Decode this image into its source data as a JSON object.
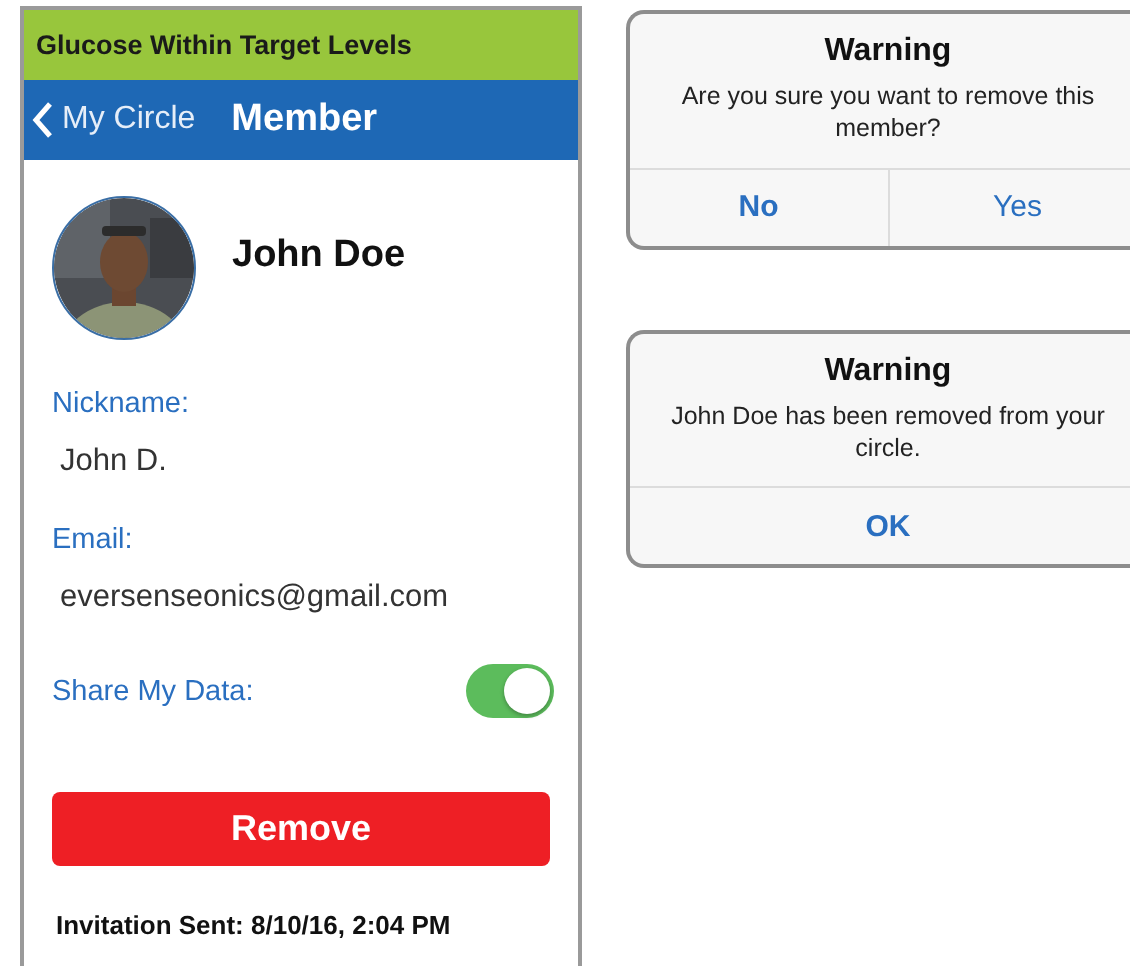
{
  "status_banner": {
    "text": "Glucose Within Target Levels"
  },
  "nav_bar": {
    "back_label": "My Circle",
    "title": "Member"
  },
  "profile": {
    "name": "John Doe"
  },
  "fields": [
    {
      "label": "Nickname:",
      "value": "John D."
    },
    {
      "label": "Email:",
      "value": "eversenseonics@gmail.com"
    }
  ],
  "share_toggle": {
    "label": "Share My Data:",
    "on": true
  },
  "remove_button": "Remove",
  "invitation_note": "Invitation Sent: 8/10/16, 2:04 PM",
  "dialogs": [
    {
      "title": "Warning",
      "message": "Are you sure you want to remove this member?",
      "buttons": [
        "No",
        "Yes"
      ]
    },
    {
      "title": "Warning",
      "message": "John Doe has been removed from your circle.",
      "buttons": [
        "OK"
      ]
    }
  ]
}
